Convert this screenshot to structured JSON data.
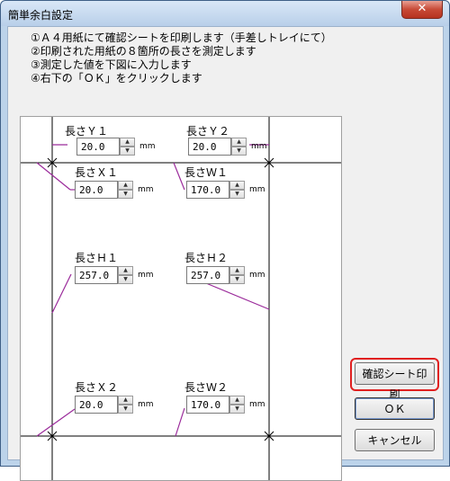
{
  "window": {
    "title": "簡単余白設定",
    "close_label": "✕"
  },
  "instructions": [
    "①Ａ４用紙にて確認シートを印刷します（手差しトレイにて）",
    "②印刷された用紙の８箇所の長さを測定します",
    "③測定した値を下図に入力します",
    "④右下の「ＯＫ」をクリックします"
  ],
  "fields": {
    "y1": {
      "label": "長さＹ１",
      "value": "20.0"
    },
    "y2": {
      "label": "長さＹ２",
      "value": "20.0"
    },
    "x1": {
      "label": "長さＸ１",
      "value": "20.0"
    },
    "w1": {
      "label": "長さＷ１",
      "value": "170.0"
    },
    "h1": {
      "label": "長さＨ１",
      "value": "257.0"
    },
    "h2": {
      "label": "長さＨ２",
      "value": "257.0"
    },
    "x2": {
      "label": "長さＸ２",
      "value": "20.0"
    },
    "w2": {
      "label": "長さＷ２",
      "value": "170.0"
    }
  },
  "unit": "mm",
  "buttons": {
    "print_sheet": "確認シート印刷",
    "ok": "ＯＫ",
    "cancel": "キャンセル"
  },
  "colors": {
    "leader_line": "#9b2b9b",
    "highlight": "#e02020"
  }
}
